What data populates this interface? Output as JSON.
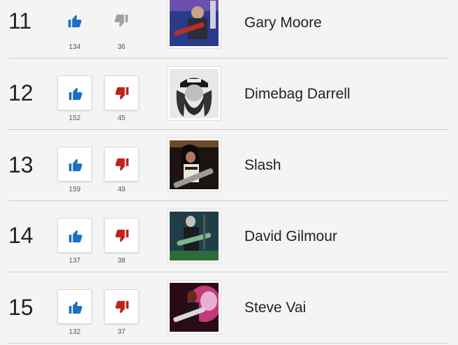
{
  "colors": {
    "upvote": "#1a6fc4",
    "downvote": "#c0221c",
    "inactive": "#a0a0a0"
  },
  "rows": [
    {
      "rank": "11",
      "name": "Gary Moore",
      "up": "134",
      "down": "36",
      "boxed": false
    },
    {
      "rank": "12",
      "name": "Dimebag Darrell",
      "up": "152",
      "down": "45",
      "boxed": true
    },
    {
      "rank": "13",
      "name": "Slash",
      "up": "159",
      "down": "49",
      "boxed": true
    },
    {
      "rank": "14",
      "name": "David Gilmour",
      "up": "137",
      "down": "38",
      "boxed": true
    },
    {
      "rank": "15",
      "name": "Steve Vai",
      "up": "132",
      "down": "37",
      "boxed": true
    }
  ],
  "icons": {
    "up": "thumbs-up-icon",
    "down": "thumbs-down-icon"
  }
}
